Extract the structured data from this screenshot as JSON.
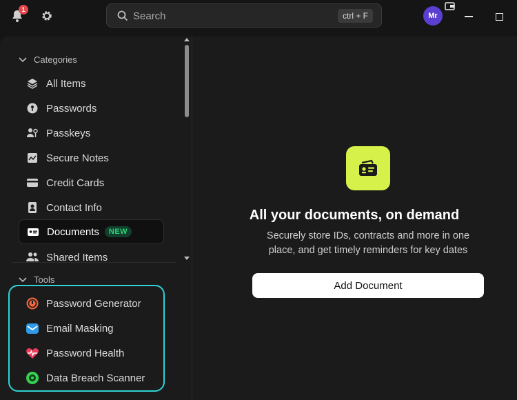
{
  "titlebar": {
    "notification_count": "1",
    "search_placeholder": "Search",
    "search_shortcut": "ctrl + F",
    "avatar_initials": "Mr"
  },
  "sidebar": {
    "categories_label": "Categories",
    "categories": [
      {
        "label": "All Items",
        "icon": "layers-icon"
      },
      {
        "label": "Passwords",
        "icon": "key-icon"
      },
      {
        "label": "Passkeys",
        "icon": "passkey-icon"
      },
      {
        "label": "Secure Notes",
        "icon": "note-icon"
      },
      {
        "label": "Credit Cards",
        "icon": "credit-card-icon"
      },
      {
        "label": "Contact Info",
        "icon": "contact-icon"
      },
      {
        "label": "Documents",
        "icon": "id-card-icon",
        "badge": "NEW",
        "active": true
      },
      {
        "label": "Shared Items",
        "icon": "people-icon"
      }
    ],
    "tools_label": "Tools",
    "tools": [
      {
        "label": "Password Generator",
        "icon": "generator-icon",
        "color": "#f0653b"
      },
      {
        "label": "Email Masking",
        "icon": "mask-icon",
        "color": "#2f9be8"
      },
      {
        "label": "Password Health",
        "icon": "heart-pulse-icon",
        "color": "#ef3b5b"
      },
      {
        "label": "Data Breach Scanner",
        "icon": "scanner-icon",
        "color": "#35d04f"
      }
    ]
  },
  "main": {
    "heading": "All your documents, on demand",
    "description": "Securely store IDs, contracts and more in one place, and get timely reminders for key dates",
    "add_button": "Add Document",
    "accent": "#d6f24a"
  }
}
